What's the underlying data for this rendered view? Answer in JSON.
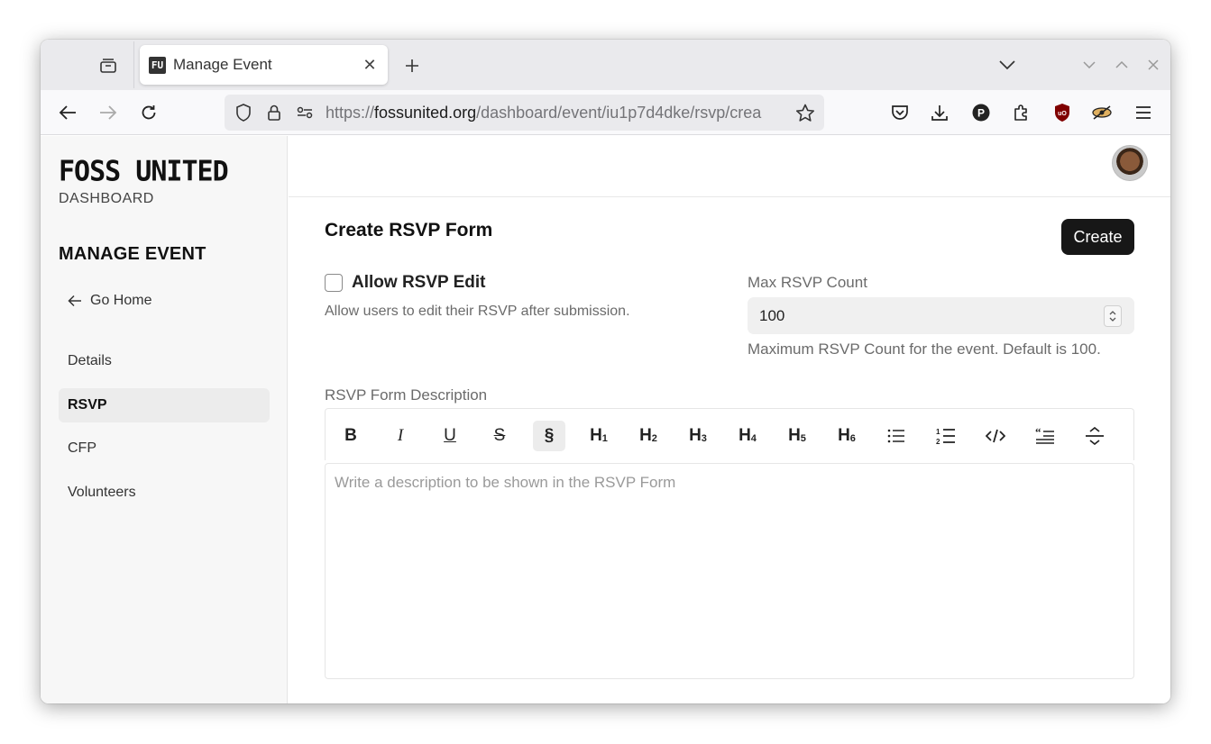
{
  "browser": {
    "tab_title": "Manage Event",
    "tab_favicon_text": "FU",
    "url_prefix": "https://",
    "url_host": "fossunited.org",
    "url_path": "/dashboard/event/iu1p7d4dke/rsvp/crea",
    "icons": {
      "tab_ghost": "tab-groups-icon",
      "tab_close": "close-icon",
      "new_tab": "plus-icon",
      "list_all": "chevron-down-icon",
      "back": "arrow-left-icon",
      "forward": "arrow-right-icon",
      "reload": "reload-icon",
      "tracking": "shield-icon",
      "lock": "lock-icon",
      "permissions": "permissions-icon",
      "bookmark": "star-icon",
      "pocket": "pocket-icon",
      "downloads": "download-icon",
      "profile": "profile-p-icon",
      "extensions": "puzzle-icon",
      "ublock": "ublock-icon",
      "extension2": "extension-icon",
      "menu": "hamburger-icon"
    }
  },
  "sidebar": {
    "logo": "FOSS UNITED",
    "logo_sub": "DASHBOARD",
    "section_title": "MANAGE EVENT",
    "go_home": "Go Home",
    "items": [
      {
        "label": "Details",
        "active": false
      },
      {
        "label": "RSVP",
        "active": true
      },
      {
        "label": "CFP",
        "active": false
      },
      {
        "label": "Volunteers",
        "active": false
      }
    ]
  },
  "main": {
    "title": "Create RSVP Form",
    "create_button": "Create",
    "allow_edit": {
      "label": "Allow RSVP Edit",
      "checked": false,
      "help": "Allow users to edit their RSVP after submission."
    },
    "max_count": {
      "label": "Max RSVP Count",
      "value": "100",
      "help": "Maximum RSVP Count for the event. Default is 100."
    },
    "description": {
      "label": "RSVP Form Description",
      "placeholder": "Write a description to be shown in the RSVP Form"
    },
    "toolbar": [
      {
        "name": "bold",
        "glyph": "B"
      },
      {
        "name": "italic",
        "glyph": "I"
      },
      {
        "name": "underline",
        "glyph": "U"
      },
      {
        "name": "strikethrough",
        "glyph": "S"
      },
      {
        "name": "paragraph",
        "glyph": "§"
      },
      {
        "name": "heading-1",
        "glyph": "H",
        "sub": "1"
      },
      {
        "name": "heading-2",
        "glyph": "H",
        "sub": "2"
      },
      {
        "name": "heading-3",
        "glyph": "H",
        "sub": "3"
      },
      {
        "name": "heading-4",
        "glyph": "H",
        "sub": "4"
      },
      {
        "name": "heading-5",
        "glyph": "H",
        "sub": "5"
      },
      {
        "name": "heading-6",
        "glyph": "H",
        "sub": "6"
      },
      {
        "name": "bullet-list",
        "glyph": "☰"
      },
      {
        "name": "numbered-list",
        "glyph": "≡"
      },
      {
        "name": "code",
        "glyph": "</>"
      },
      {
        "name": "blockquote",
        "glyph": "❝"
      },
      {
        "name": "horizontal-rule",
        "glyph": "⇕"
      }
    ]
  }
}
